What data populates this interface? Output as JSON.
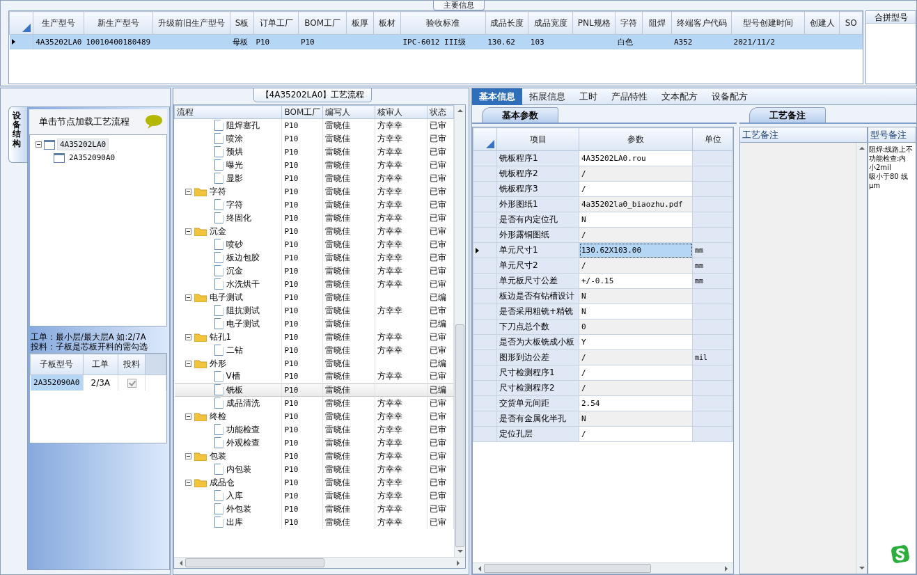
{
  "main_info": {
    "title": "主要信息",
    "columns": [
      "生产型号",
      "新生产型号",
      "升级前旧生产型号",
      "S板",
      "订单工厂",
      "BOM工厂",
      "板厚",
      "板材",
      "验收标准",
      "成品长度",
      "成品宽度",
      "PNL规格",
      "字符",
      "阻焊",
      "终端客户代码",
      "型号创建时间",
      "创建人",
      "SO"
    ],
    "rows": [
      {
        "selected": true,
        "cells": [
          "4A35202LA0",
          "10010400180489",
          null,
          "母板",
          "P10",
          "P10",
          null,
          null,
          "IPC-6012 III级",
          "130.62",
          "103",
          null,
          "白色",
          null,
          "A352",
          "2021/11/2",
          null,
          null
        ]
      }
    ],
    "merge_panel": {
      "title": "合拼型号"
    }
  },
  "structure": {
    "side_tab": "设备结构",
    "tree_header": "单击节点加载工艺流程",
    "tree": [
      {
        "label": "4A35202LA0",
        "expanded": true,
        "selected": true,
        "children": [
          {
            "label": "2A352090A0",
            "selected": false
          }
        ]
      }
    ],
    "hints": [
      "工单：最小层/最大层A 如:2/7A",
      "投料：子板是芯板开料的需勾选"
    ],
    "sub_table": {
      "columns": [
        "子板型号",
        "工单",
        "投料"
      ],
      "rows": [
        {
          "model": "2A352090A0",
          "order": "2/3A",
          "checked": true,
          "disabled": true
        }
      ]
    }
  },
  "flow": {
    "title": "【4A35202LA0】工艺流程",
    "columns": [
      "流程",
      "BOM工厂",
      "编写人",
      "核审人",
      "状态"
    ],
    "rows": [
      {
        "children": [
          {
            "kind": "step",
            "flow": "阻焊塞孔",
            "bom": "P10",
            "writer": "雷晓佳",
            "reviewer": "方幸幸",
            "status": "已审",
            "selected": false
          },
          {
            "kind": "step",
            "flow": "喷涂",
            "bom": "P10",
            "writer": "雷晓佳",
            "reviewer": "方幸幸",
            "status": "已审",
            "selected": false
          },
          {
            "kind": "step",
            "flow": "预烘",
            "bom": "P10",
            "writer": "雷晓佳",
            "reviewer": "方幸幸",
            "status": "已审",
            "selected": false
          },
          {
            "kind": "step",
            "flow": "曝光",
            "bom": "P10",
            "writer": "雷晓佳",
            "reviewer": "方幸幸",
            "status": "已审",
            "selected": false
          },
          {
            "kind": "step",
            "flow": "显影",
            "bom": "P10",
            "writer": "雷晓佳",
            "reviewer": "方幸幸",
            "status": "已审",
            "selected": false
          }
        ]
      },
      {
        "kind": "folder",
        "flow": "字符",
        "bom": "P10",
        "writer": "雷晓佳",
        "reviewer": "方幸幸",
        "status": "已审",
        "selected": false,
        "expanded": true,
        "children": [
          {
            "kind": "step",
            "flow": "字符",
            "bom": "P10",
            "writer": "雷晓佳",
            "reviewer": "方幸幸",
            "status": "已审",
            "selected": false
          },
          {
            "kind": "step",
            "flow": "终固化",
            "bom": "P10",
            "writer": "雷晓佳",
            "reviewer": "方幸幸",
            "status": "已审",
            "selected": false
          }
        ]
      },
      {
        "kind": "folder",
        "flow": "沉金",
        "bom": "P10",
        "writer": "雷晓佳",
        "reviewer": "方幸幸",
        "status": "已审",
        "selected": false,
        "expanded": true,
        "children": [
          {
            "kind": "step",
            "flow": "喷砂",
            "bom": "P10",
            "writer": "雷晓佳",
            "reviewer": "方幸幸",
            "status": "已审",
            "selected": false
          },
          {
            "kind": "step",
            "flow": "板边包胶",
            "bom": "P10",
            "writer": "雷晓佳",
            "reviewer": "方幸幸",
            "status": "已审",
            "selected": false
          },
          {
            "kind": "step",
            "flow": "沉金",
            "bom": "P10",
            "writer": "雷晓佳",
            "reviewer": "方幸幸",
            "status": "已审",
            "selected": false
          },
          {
            "kind": "step",
            "flow": "水洗烘干",
            "bom": "P10",
            "writer": "雷晓佳",
            "reviewer": "方幸幸",
            "status": "已审",
            "selected": false
          }
        ]
      },
      {
        "kind": "folder",
        "flow": "电子测试",
        "bom": "P10",
        "writer": "雷晓佳",
        "status": "已编",
        "selected": false,
        "expanded": true,
        "children": [
          {
            "kind": "step",
            "flow": "阻抗测试",
            "bom": "P10",
            "writer": "雷晓佳",
            "reviewer": "方幸幸",
            "status": "已审",
            "selected": false
          },
          {
            "kind": "step",
            "flow": "电子测试",
            "bom": "P10",
            "writer": "雷晓佳",
            "status": "已编",
            "selected": false
          }
        ]
      },
      {
        "kind": "folder",
        "flow": "钻孔1",
        "bom": "P10",
        "writer": "雷晓佳",
        "reviewer": "方幸幸",
        "status": "已审",
        "selected": false,
        "expanded": true,
        "children": [
          {
            "kind": "step",
            "flow": "二钻",
            "bom": "P10",
            "writer": "雷晓佳",
            "reviewer": "方幸幸",
            "status": "已审",
            "selected": false
          }
        ]
      },
      {
        "kind": "folder",
        "flow": "外形",
        "bom": "P10",
        "writer": "雷晓佳",
        "status": "已编",
        "selected": false,
        "expanded": true,
        "children": [
          {
            "kind": "step",
            "flow": "V槽",
            "bom": "P10",
            "writer": "雷晓佳",
            "reviewer": "方幸幸",
            "status": "已审",
            "selected": false
          },
          {
            "kind": "step",
            "flow": "铣板",
            "bom": "P10",
            "writer": "雷晓佳",
            "status": "已编",
            "selected": true
          },
          {
            "kind": "step",
            "flow": "成品清洗",
            "bom": "P10",
            "writer": "雷晓佳",
            "reviewer": "方幸幸",
            "status": "已审",
            "selected": false
          }
        ]
      },
      {
        "kind": "folder",
        "flow": "终检",
        "bom": "P10",
        "writer": "雷晓佳",
        "reviewer": "方幸幸",
        "status": "已审",
        "selected": false,
        "expanded": true,
        "children": [
          {
            "kind": "step",
            "flow": "功能检查",
            "bom": "P10",
            "writer": "雷晓佳",
            "reviewer": "方幸幸",
            "status": "已审",
            "selected": false
          },
          {
            "kind": "step",
            "flow": "外观检查",
            "bom": "P10",
            "writer": "雷晓佳",
            "reviewer": "方幸幸",
            "status": "已审",
            "selected": false
          }
        ]
      },
      {
        "kind": "folder",
        "flow": "包装",
        "bom": "P10",
        "writer": "雷晓佳",
        "reviewer": "方幸幸",
        "status": "已审",
        "selected": false,
        "expanded": true,
        "children": [
          {
            "kind": "step",
            "flow": "内包装",
            "bom": "P10",
            "writer": "雷晓佳",
            "reviewer": "方幸幸",
            "status": "已审",
            "selected": false
          }
        ]
      },
      {
        "kind": "folder",
        "flow": "成品仓",
        "bom": "P10",
        "writer": "雷晓佳",
        "reviewer": "方幸幸",
        "status": "已审",
        "selected": false,
        "expanded": true,
        "children": [
          {
            "kind": "step",
            "flow": "入库",
            "bom": "P10",
            "writer": "雷晓佳",
            "reviewer": "方幸幸",
            "status": "已审",
            "selected": false
          },
          {
            "kind": "step",
            "flow": "外包装",
            "bom": "P10",
            "writer": "雷晓佳",
            "reviewer": "方幸幸",
            "status": "已审",
            "selected": false
          },
          {
            "kind": "step",
            "flow": "出库",
            "bom": "P10",
            "writer": "雷晓佳",
            "reviewer": "方幸幸",
            "status": "已审",
            "selected": false
          }
        ]
      }
    ]
  },
  "details": {
    "tabs": [
      {
        "label": "基本信息",
        "selected": true
      },
      {
        "label": "拓展信息",
        "selected": false
      },
      {
        "label": "工时",
        "selected": false
      },
      {
        "label": "产品特性",
        "selected": false
      },
      {
        "label": "文本配方",
        "selected": false
      },
      {
        "label": "设备配方",
        "selected": false
      }
    ],
    "params": {
      "tab": "基本参数",
      "columns": [
        "项目",
        "参数",
        "单位"
      ],
      "rows": [
        {
          "item": "铣板程序1",
          "value": "4A35202LA0.rou",
          "selected": false
        },
        {
          "item": "铣板程序2",
          "value": "/",
          "selected": false
        },
        {
          "item": "铣板程序3",
          "value": "/",
          "selected": false
        },
        {
          "item": "外形图纸1",
          "value": "4a35202la0_biaozhu.pdf",
          "selected": false
        },
        {
          "item": "是否有内定位孔",
          "value": "N",
          "selected": false
        },
        {
          "item": "外形露铜图纸",
          "value": "/",
          "selected": false
        },
        {
          "item": "单元尺寸1",
          "value": "130.62X103.00",
          "unit": "mm",
          "selected": true
        },
        {
          "item": "单元尺寸2",
          "value": "/",
          "unit": "mm",
          "selected": false
        },
        {
          "item": "单元板尺寸公差",
          "value": "+/-0.15",
          "unit": "mm",
          "selected": false
        },
        {
          "item": "板边是否有钻槽设计",
          "value": "N",
          "selected": false
        },
        {
          "item": "是否采用粗铣+精铣",
          "value": "N",
          "selected": false
        },
        {
          "item": "下刀点总个数",
          "value": "0",
          "selected": false
        },
        {
          "item": "是否为大板铣成小板",
          "value": "Y",
          "selected": false
        },
        {
          "item": "图形到边公差",
          "value": "/",
          "unit": "mil",
          "selected": false
        },
        {
          "item": "尺寸检测程序1",
          "value": "/",
          "selected": false
        },
        {
          "item": "尺寸检测程序2",
          "value": "/",
          "selected": false
        },
        {
          "item": "交货单元间距",
          "value": "2.54",
          "selected": false
        },
        {
          "item": "是否有金属化半孔",
          "value": "N",
          "selected": false
        },
        {
          "item": "定位孔层",
          "value": "/",
          "selected": false
        }
      ]
    },
    "notes": {
      "tab": "工艺备注",
      "columns": [
        "工艺备注",
        "型号备注"
      ],
      "model_notes": [
        "阻焊:线路上不",
        "功能检查:内",
        "小2mil",
        "吸小于80 线",
        "μm"
      ]
    }
  }
}
